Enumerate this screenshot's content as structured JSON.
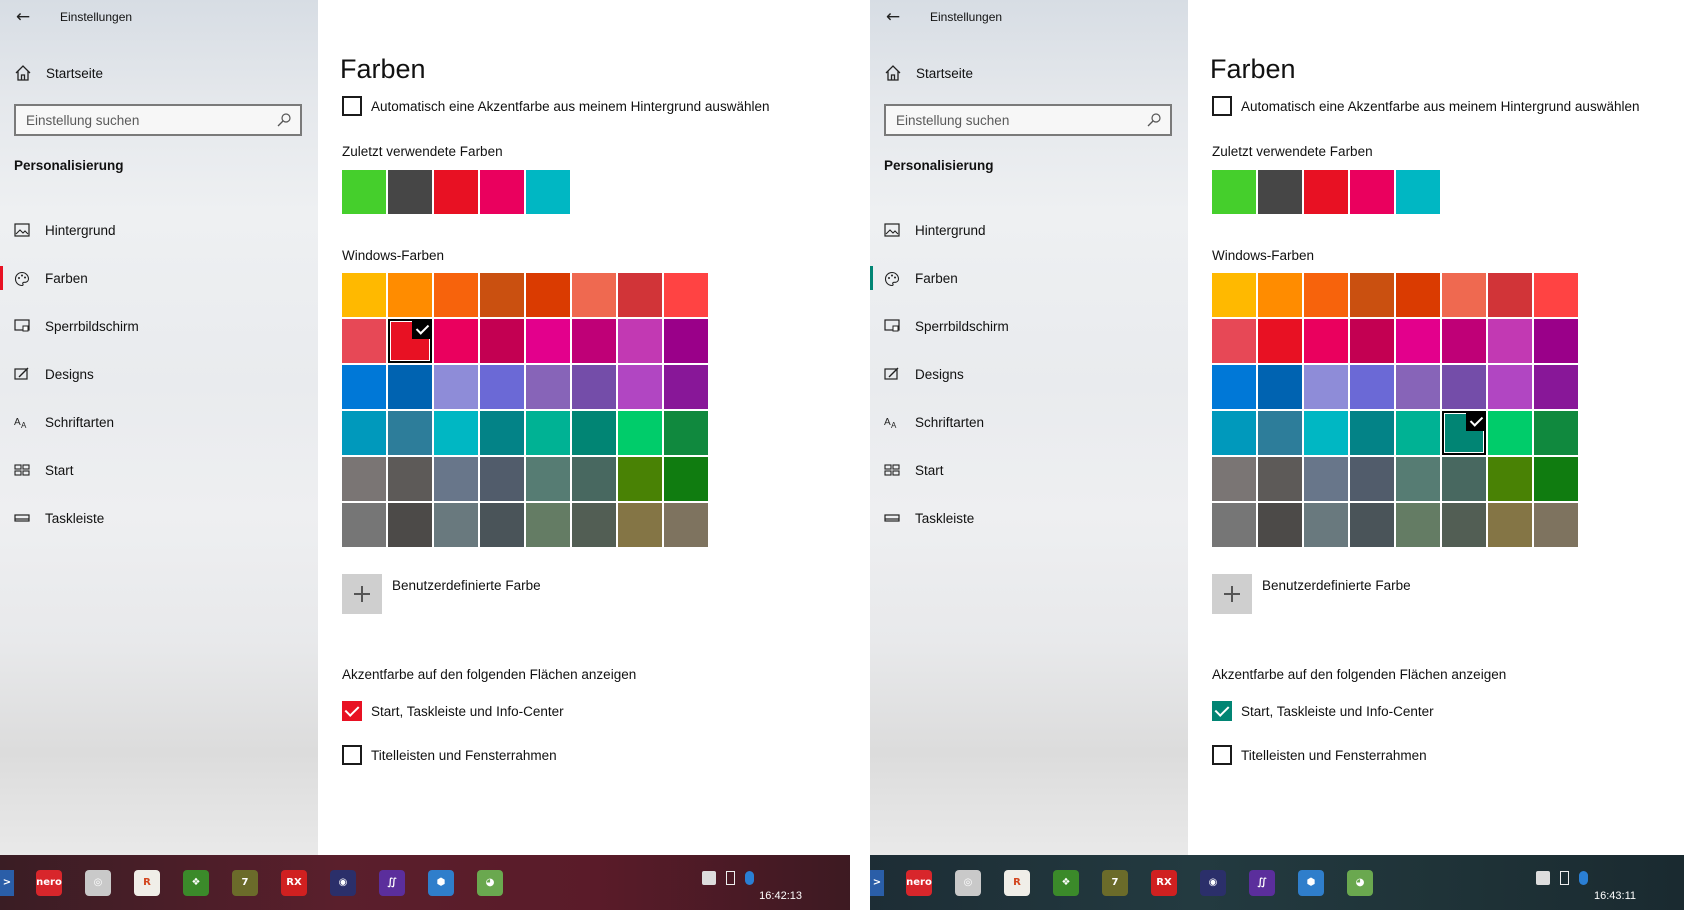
{
  "panels": [
    {
      "window": {
        "title": "Einstellungen",
        "back_icon": "←"
      },
      "sidebar": {
        "home_label": "Startseite",
        "search_placeholder": "Einstellung suchen",
        "section_title": "Personalisierung",
        "items": [
          {
            "label": "Hintergrund",
            "icon": "image-icon",
            "active": false
          },
          {
            "label": "Farben",
            "icon": "palette-icon",
            "active": true
          },
          {
            "label": "Sperrbildschirm",
            "icon": "lockscreen-icon",
            "active": false
          },
          {
            "label": "Designs",
            "icon": "designs-icon",
            "active": false
          },
          {
            "label": "Schriftarten",
            "icon": "fonts-icon",
            "active": false
          },
          {
            "label": "Start",
            "icon": "start-icon",
            "active": false
          },
          {
            "label": "Taskleiste",
            "icon": "taskbar-icon",
            "active": false
          }
        ],
        "active_indicator_color": "#e81123"
      },
      "main": {
        "title": "Farben",
        "auto_accent_label": "Automatisch eine Akzentfarbe aus meinem Hintergrund auswählen",
        "auto_accent_checked": false,
        "recent_label": "Zuletzt verwendete Farben",
        "recent_colors": [
          "#45cf2c",
          "#464646",
          "#e81123",
          "#ea005e",
          "#00b7c3"
        ],
        "windows_colors_label": "Windows-Farben",
        "windows_colors": [
          [
            "#ffb900",
            "#ff8c00",
            "#f7630c",
            "#ca5010",
            "#da3b01",
            "#ef6950",
            "#d13438",
            "#ff4343"
          ],
          [
            "#e74856",
            "#e81123",
            "#ea005e",
            "#c30052",
            "#e3008c",
            "#bf0077",
            "#c239b3",
            "#9a0089"
          ],
          [
            "#0078d7",
            "#0063b1",
            "#8e8cd8",
            "#6b69d6",
            "#8764b8",
            "#744da9",
            "#b146c2",
            "#881798"
          ],
          [
            "#0099bc",
            "#2d7d9a",
            "#00b7c3",
            "#038387",
            "#00b294",
            "#018574",
            "#00cc6a",
            "#10893e"
          ],
          [
            "#7a7574",
            "#5d5a58",
            "#68768a",
            "#515c6b",
            "#567c73",
            "#486860",
            "#498205",
            "#107c10"
          ],
          [
            "#767676",
            "#4c4a48",
            "#69797e",
            "#4a5459",
            "#647c64",
            "#525e54",
            "#847545",
            "#7e735f"
          ]
        ],
        "selected_cell": [
          1,
          1
        ],
        "custom_color_label": "Benutzerdefinierte Farbe",
        "surfaces_label": "Akzentfarbe auf den folgenden Flächen anzeigen",
        "start_taskbar_label": "Start, Taskleiste und Info-Center",
        "start_taskbar_checked": true,
        "titlebars_label": "Titelleisten und Fensterrahmen",
        "titlebars_checked": false,
        "accent": "#e81123"
      },
      "taskbar": {
        "icons": [
          "powershell-icon",
          "nero-icon",
          "browser-globe-icon",
          "reaper-icon",
          "paint-icon",
          "seven-icon",
          "rx-icon",
          "disc-icon",
          "visual-studio-icon",
          "apps-icon",
          "android-icon"
        ],
        "clock": "16:42:13"
      }
    },
    {
      "window": {
        "title": "Einstellungen",
        "back_icon": "←"
      },
      "sidebar": {
        "home_label": "Startseite",
        "search_placeholder": "Einstellung suchen",
        "section_title": "Personalisierung",
        "items": [
          {
            "label": "Hintergrund",
            "icon": "image-icon",
            "active": false
          },
          {
            "label": "Farben",
            "icon": "palette-icon",
            "active": true
          },
          {
            "label": "Sperrbildschirm",
            "icon": "lockscreen-icon",
            "active": false
          },
          {
            "label": "Designs",
            "icon": "designs-icon",
            "active": false
          },
          {
            "label": "Schriftarten",
            "icon": "fonts-icon",
            "active": false
          },
          {
            "label": "Start",
            "icon": "start-icon",
            "active": false
          },
          {
            "label": "Taskleiste",
            "icon": "taskbar-icon",
            "active": false
          }
        ],
        "active_indicator_color": "#018574"
      },
      "main": {
        "title": "Farben",
        "auto_accent_label": "Automatisch eine Akzentfarbe aus meinem Hintergrund auswählen",
        "auto_accent_checked": false,
        "recent_label": "Zuletzt verwendete Farben",
        "recent_colors": [
          "#45cf2c",
          "#464646",
          "#e81123",
          "#ea005e",
          "#00b7c3"
        ],
        "windows_colors_label": "Windows-Farben",
        "windows_colors": [
          [
            "#ffb900",
            "#ff8c00",
            "#f7630c",
            "#ca5010",
            "#da3b01",
            "#ef6950",
            "#d13438",
            "#ff4343"
          ],
          [
            "#e74856",
            "#e81123",
            "#ea005e",
            "#c30052",
            "#e3008c",
            "#bf0077",
            "#c239b3",
            "#9a0089"
          ],
          [
            "#0078d7",
            "#0063b1",
            "#8e8cd8",
            "#6b69d6",
            "#8764b8",
            "#744da9",
            "#b146c2",
            "#881798"
          ],
          [
            "#0099bc",
            "#2d7d9a",
            "#00b7c3",
            "#038387",
            "#00b294",
            "#018574",
            "#00cc6a",
            "#10893e"
          ],
          [
            "#7a7574",
            "#5d5a58",
            "#68768a",
            "#515c6b",
            "#567c73",
            "#486860",
            "#498205",
            "#107c10"
          ],
          [
            "#767676",
            "#4c4a48",
            "#69797e",
            "#4a5459",
            "#647c64",
            "#525e54",
            "#847545",
            "#7e735f"
          ]
        ],
        "selected_cell": [
          3,
          5
        ],
        "custom_color_label": "Benutzerdefinierte Farbe",
        "surfaces_label": "Akzentfarbe auf den folgenden Flächen anzeigen",
        "start_taskbar_label": "Start, Taskleiste und Info-Center",
        "start_taskbar_checked": true,
        "titlebars_label": "Titelleisten und Fensterrahmen",
        "titlebars_checked": false,
        "accent": "#018574"
      },
      "taskbar": {
        "icons": [
          "powershell-icon",
          "nero-icon",
          "browser-globe-icon",
          "reaper-icon",
          "paint-icon",
          "seven-icon",
          "rx-icon",
          "disc-icon",
          "visual-studio-icon",
          "apps-icon",
          "android-icon"
        ],
        "clock": "16:43:11"
      }
    }
  ]
}
